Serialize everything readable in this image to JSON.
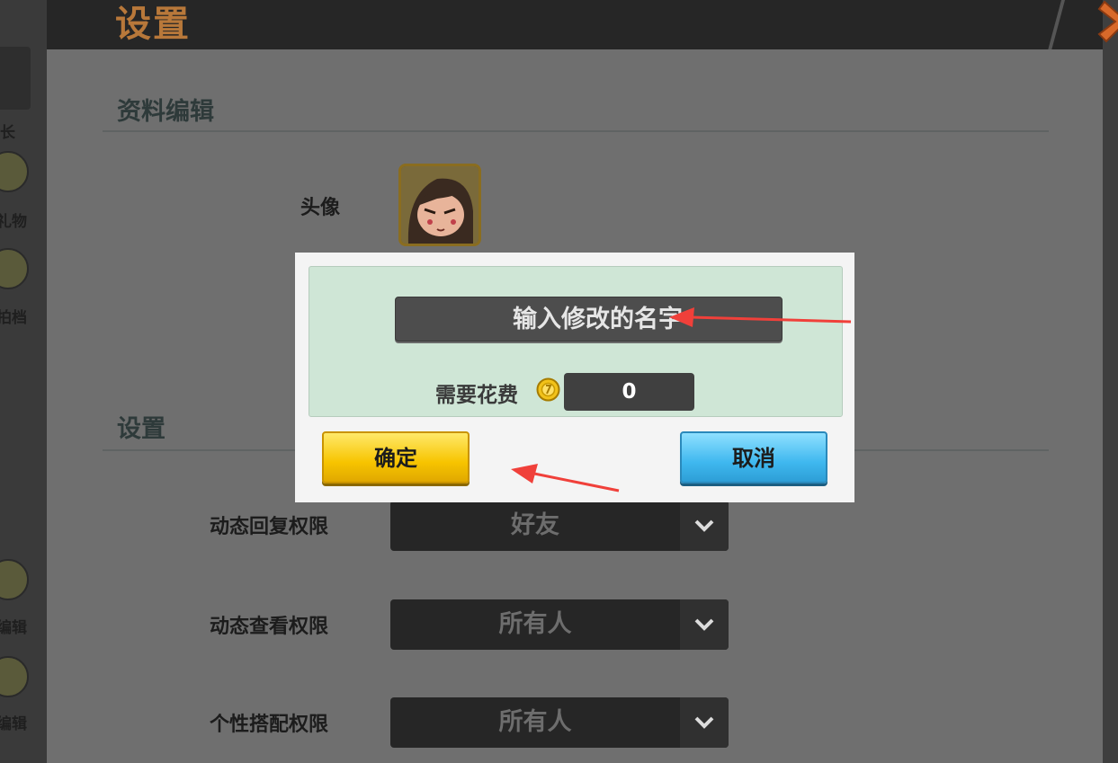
{
  "header": {
    "title": "设置"
  },
  "sidebar": {
    "items": [
      {
        "label": "长"
      },
      {
        "label": "礼物"
      },
      {
        "label": "拍档"
      },
      {
        "label": "编辑"
      },
      {
        "label": "编辑"
      }
    ]
  },
  "profile_section": {
    "title": "资料编辑",
    "avatar_label": "头像"
  },
  "settings_section": {
    "title": "设置",
    "rows": [
      {
        "label": "动态回复权限",
        "value": "好友"
      },
      {
        "label": "动态查看权限",
        "value": "所有人"
      },
      {
        "label": "个性搭配权限",
        "value": "所有人"
      }
    ]
  },
  "rename_dialog": {
    "name_placeholder": "输入修改的名字",
    "cost_label": "需要花费",
    "cost_value": "0",
    "confirm_label": "确定",
    "cancel_label": "取消"
  },
  "colors": {
    "header_title": "#b8783a",
    "confirm_button": "#f7c400",
    "cancel_button": "#3fb8ef",
    "annotation_arrow": "#f0403a"
  },
  "icons": {
    "close": "close-x-icon",
    "coin": "coin-icon",
    "dropdown": "chevron-down-icon",
    "avatar": "avatar"
  }
}
